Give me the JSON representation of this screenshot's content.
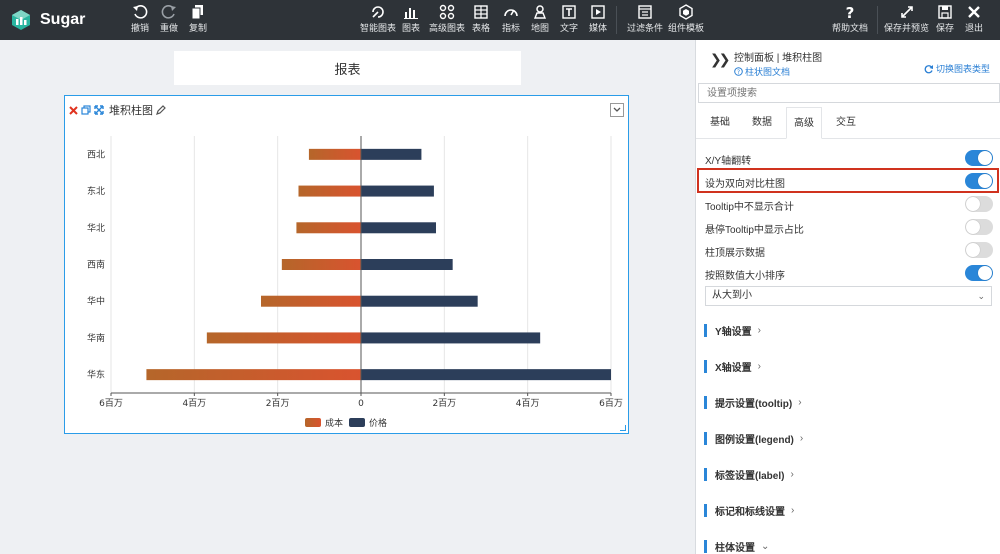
{
  "app": {
    "name": "Sugar"
  },
  "toolbar": {
    "left": [
      {
        "icon": "undo-icon",
        "label": "撤销"
      },
      {
        "icon": "redo-icon",
        "label": "重做"
      },
      {
        "icon": "copy-icon",
        "label": "复制"
      }
    ],
    "center": [
      {
        "icon": "smart-chart-icon",
        "label": "智能图表"
      },
      {
        "icon": "bar-chart-icon",
        "label": "图表"
      },
      {
        "icon": "advanced-chart-icon",
        "label": "高级图表"
      },
      {
        "icon": "table-icon",
        "label": "表格"
      },
      {
        "icon": "gauge-icon",
        "label": "指标"
      },
      {
        "icon": "map-pin-icon",
        "label": "地图"
      },
      {
        "icon": "text-icon",
        "label": "文字"
      },
      {
        "icon": "media-icon",
        "label": "媒体"
      },
      {
        "icon": "filter-icon",
        "label": "过滤条件"
      },
      {
        "icon": "component-template-icon",
        "label": "组件模板"
      }
    ],
    "right": [
      {
        "icon": "help-icon",
        "label": "帮助文档"
      },
      {
        "icon": "save-preview-icon",
        "label": "保存并预览"
      },
      {
        "icon": "save-icon",
        "label": "保存"
      },
      {
        "icon": "exit-icon",
        "label": "退出"
      }
    ]
  },
  "report": {
    "title": "报表"
  },
  "card": {
    "title": "堆积柱图"
  },
  "chart_data": {
    "type": "bar",
    "orientation": "horizontal",
    "layout": "diverging",
    "categories": [
      "西北",
      "东北",
      "华北",
      "西南",
      "华中",
      "华南",
      "华东"
    ],
    "series": [
      {
        "name": "成本",
        "values": [
          -1.25,
          -1.5,
          -1.55,
          -1.9,
          -2.4,
          -3.7,
          -5.15
        ],
        "color_from": "#d9532f",
        "color_to": "#b5662a"
      },
      {
        "name": "价格",
        "values": [
          1.45,
          1.75,
          1.8,
          2.2,
          2.8,
          4.3,
          6.0
        ],
        "color": "#2c3e5a"
      }
    ],
    "xlim": [
      -6,
      6
    ],
    "x_ticks": [
      {
        "value": -6,
        "label": "6百万"
      },
      {
        "value": -4,
        "label": "4百万"
      },
      {
        "value": -2,
        "label": "2百万"
      },
      {
        "value": 0,
        "label": "0"
      },
      {
        "value": 2,
        "label": "2百万"
      },
      {
        "value": 4,
        "label": "4百万"
      },
      {
        "value": 6,
        "label": "6百万"
      }
    ],
    "grid": true,
    "legend_position": "bottom-center"
  },
  "panel": {
    "breadcrumb": "控制面板 | 堆积柱图",
    "doc_link": "柱状图文档",
    "switch_type": "切换图表类型",
    "search_placeholder": "设置项搜索",
    "tabs": [
      {
        "label": "基础",
        "active": false
      },
      {
        "label": "数据",
        "active": false
      },
      {
        "label": "高级",
        "active": true
      },
      {
        "label": "交互",
        "active": false
      }
    ],
    "options": [
      {
        "label": "X/Y轴翻转",
        "on": true
      },
      {
        "label": "设为双向对比柱图",
        "on": true
      },
      {
        "label": "Tooltip中不显示合计",
        "on": false
      },
      {
        "label": "悬停Tooltip中显示占比",
        "on": false
      },
      {
        "label": "柱顶展示数据",
        "on": false
      },
      {
        "label": "按照数值大小排序",
        "on": true
      }
    ],
    "sort_order": "从大到小",
    "sections": [
      {
        "label": "Y轴设置",
        "expanded": false
      },
      {
        "label": "X轴设置",
        "expanded": false
      },
      {
        "label": "提示设置(tooltip)",
        "expanded": false
      },
      {
        "label": "图例设置(legend)",
        "expanded": false
      },
      {
        "label": "标签设置(label)",
        "expanded": false
      },
      {
        "label": "标记和标线设置",
        "expanded": false
      },
      {
        "label": "柱体设置",
        "expanded": true
      }
    ]
  }
}
